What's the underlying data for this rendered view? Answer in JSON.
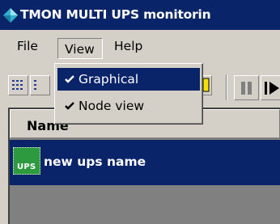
{
  "window": {
    "title": "TMON MULTI UPS monitorin",
    "logo_icon": "diamond-logo-icon"
  },
  "menubar": {
    "items": [
      {
        "label": "File"
      },
      {
        "label": "View"
      },
      {
        "label": "Help"
      }
    ],
    "open_menu": "View"
  },
  "view_menu": {
    "items": [
      {
        "label": "Graphical",
        "checked": true,
        "highlighted": true
      },
      {
        "label": "Node view",
        "checked": true,
        "highlighted": false
      }
    ]
  },
  "toolbar": {
    "buttons": [
      {
        "icon": "grid-view-icon"
      },
      {
        "icon": "list-view-icon"
      },
      {
        "icon": "yellow-note-icon"
      },
      {
        "icon": "pause-icon"
      },
      {
        "icon": "play-icon"
      }
    ]
  },
  "list": {
    "column_header": "Name",
    "rows": [
      {
        "icon_text": "UPS",
        "name": "new ups name",
        "selected": true
      }
    ]
  },
  "colors": {
    "title_bar": "#0a246a",
    "selection": "#0a246a",
    "face": "#d4d0c8",
    "ups_icon": "#2e9a3f"
  }
}
